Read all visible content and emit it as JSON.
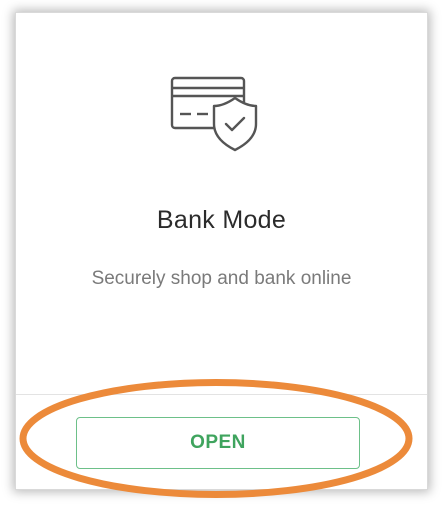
{
  "card": {
    "icon": "credit-card-shield-icon",
    "title": "Bank Mode",
    "subtitle": "Securely shop and bank online",
    "open_button_label": "OPEN"
  },
  "colors": {
    "accent_green": "#3fa45e",
    "button_border": "#6dc089",
    "highlight_orange": "#ec8a3a",
    "icon_stroke": "#555555"
  }
}
